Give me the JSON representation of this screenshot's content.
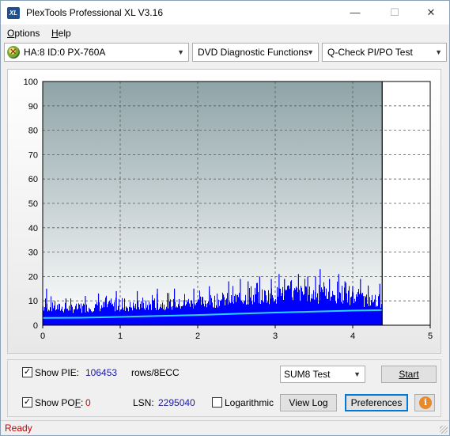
{
  "window": {
    "title": "PlexTools Professional XL V3.16",
    "icon_text": "XL",
    "minimize_glyph": "—",
    "maximize_glyph": "☐",
    "close_glyph": "✕"
  },
  "menu": {
    "options_accel": "O",
    "options_rest": "ptions",
    "help_accel": "H",
    "help_rest": "elp"
  },
  "toolbar": {
    "drive": "HA:8 ID:0  PX-760A",
    "function": "DVD Diagnostic Functions",
    "test": "Q-Check PI/PO Test"
  },
  "chart_data": {
    "type": "bar",
    "title": "",
    "xlabel": "",
    "ylabel": "",
    "xlim": [
      0,
      5
    ],
    "ylim": [
      0,
      100
    ],
    "x_ticks": [
      "0",
      "1",
      "2",
      "3",
      "4",
      "5"
    ],
    "y_ticks": [
      "0",
      "10",
      "20",
      "30",
      "40",
      "50",
      "60",
      "70",
      "80",
      "90",
      "100"
    ],
    "grid": true,
    "data_end_x": 4.38,
    "series": [
      {
        "name": "PIE",
        "color": "#0000ff",
        "style": "bars",
        "envelope_x": [
          0,
          0.25,
          0.5,
          0.75,
          1.0,
          1.25,
          1.5,
          1.75,
          2.0,
          2.25,
          2.5,
          2.75,
          3.0,
          3.25,
          3.5,
          3.75,
          4.0,
          4.25,
          4.38
        ],
        "envelope_y": [
          10,
          9,
          9,
          10,
          10,
          10,
          11,
          11,
          12,
          13,
          14,
          15,
          16,
          17,
          16,
          15,
          14,
          13,
          13
        ],
        "peak_x": [
          0.05,
          0.3,
          0.55,
          0.72,
          0.95,
          1.22,
          1.48,
          1.7,
          1.95,
          2.15,
          2.4,
          2.55,
          2.65,
          2.8,
          2.95,
          3.05,
          3.12,
          3.2,
          3.3,
          3.42,
          3.52,
          3.58,
          3.7,
          3.82,
          3.9,
          4.0,
          4.1,
          4.2,
          4.35
        ],
        "peak_y": [
          15,
          11,
          12,
          13,
          14,
          14,
          15,
          15,
          15,
          16,
          18,
          19,
          18,
          20,
          19,
          21,
          19,
          18,
          21,
          20,
          20,
          23,
          19,
          21,
          18,
          16,
          19,
          16,
          17
        ]
      },
      {
        "name": "PIE Sum8 average",
        "color": "#2ad3ff",
        "style": "line",
        "x": [
          0,
          0.5,
          1.0,
          1.5,
          2.0,
          2.5,
          3.0,
          3.5,
          4.0,
          4.38
        ],
        "y": [
          3,
          3.1,
          3.4,
          3.8,
          4.2,
          4.7,
          5.2,
          5.6,
          6.0,
          6.2
        ]
      }
    ],
    "colors": {
      "plot_bg_top": "#8fa4a8",
      "plot_bg_bottom": "#ffffff",
      "grid": "#5a5a5a"
    }
  },
  "panel": {
    "show_pie_label": "Show PIE:",
    "show_pie_checked": true,
    "pie_value": "106453",
    "pie_unit": "rows/8ECC",
    "show_pof_label_pre": "Show PO",
    "show_pof_label_accel": "F",
    "show_pof_label_post": ":",
    "show_pof_checked": true,
    "pof_value": "0",
    "lsn_label": "LSN:",
    "lsn_value": "2295040",
    "logarithmic_label": "Logarithmic",
    "logarithmic_checked": false,
    "sum_test_option": "SUM8 Test",
    "start_label": "Start",
    "view_log_label": "View Log",
    "preferences_label": "Preferences",
    "info_glyph": "i"
  },
  "status": {
    "text": "Ready"
  }
}
